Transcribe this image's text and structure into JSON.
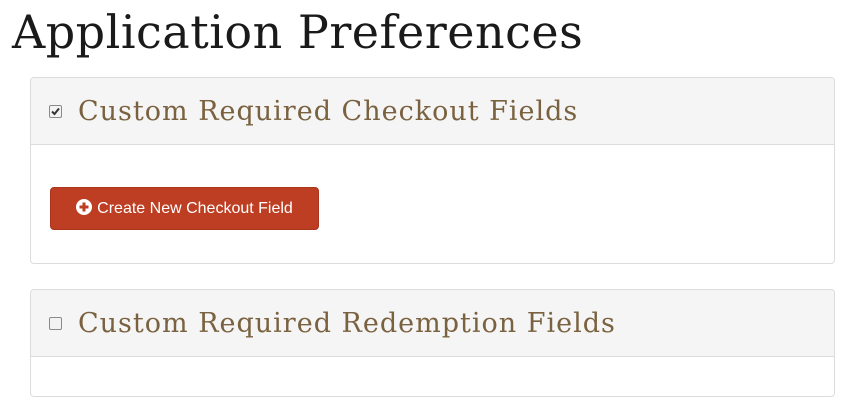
{
  "page": {
    "title": "Application Preferences"
  },
  "panels": [
    {
      "title": "Custom Required Checkout Fields",
      "checked": true,
      "button_label": "Create New Checkout Field",
      "button_icon": "plus-circle-icon"
    },
    {
      "title": "Custom Required Redemption Fields",
      "checked": false
    }
  ],
  "colors": {
    "title_text": "#1a1a1a",
    "panel_title_text": "#7a6240",
    "panel_heading_bg": "#f5f5f5",
    "button_bg": "#bd3e22",
    "button_text": "#ffffff"
  }
}
